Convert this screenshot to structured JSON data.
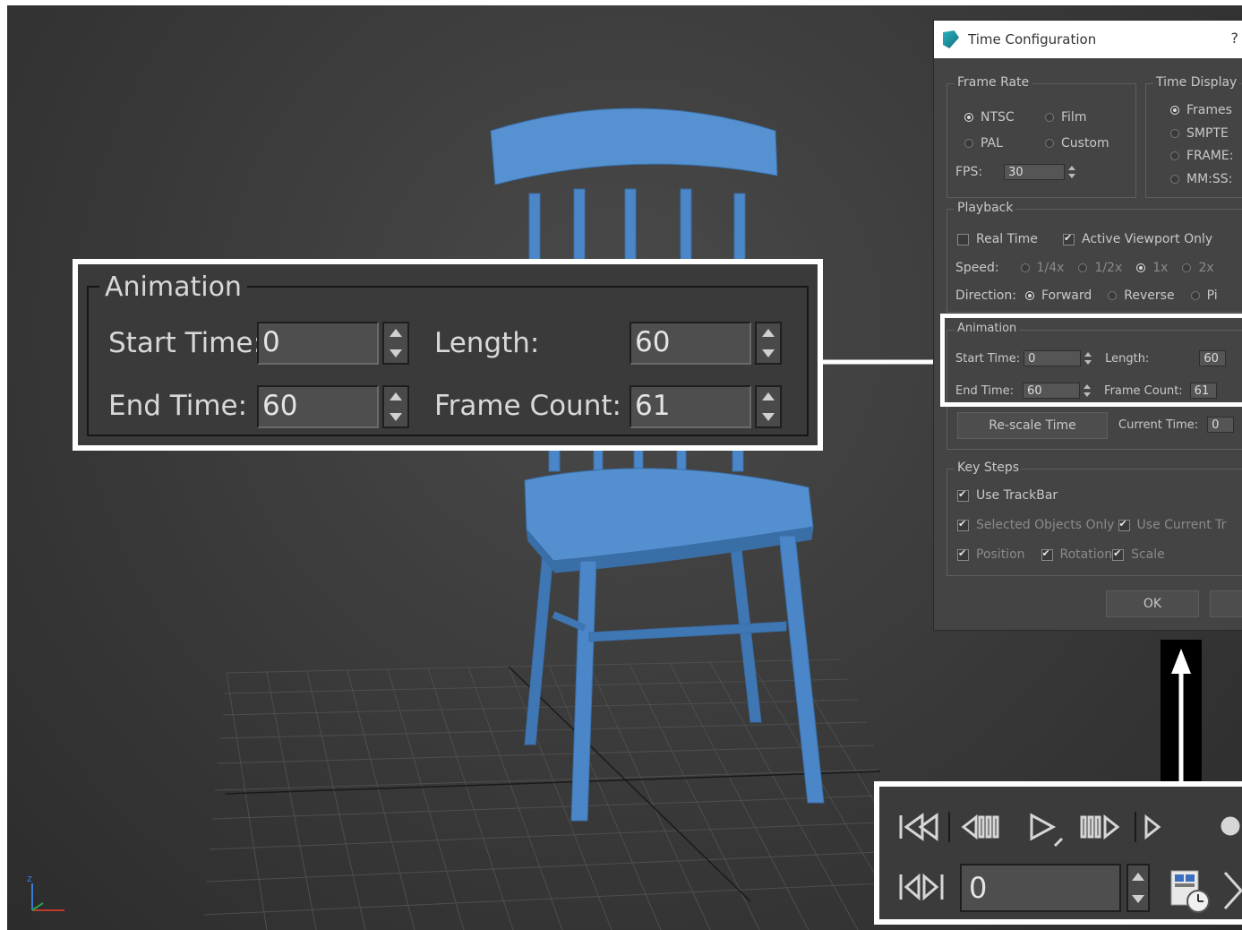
{
  "dialog": {
    "title": "Time Configuration",
    "help_glyph": "?",
    "frame_rate": {
      "label": "Frame Rate",
      "ntsc": "NTSC",
      "film": "Film",
      "pal": "PAL",
      "custom": "Custom",
      "fps_label": "FPS:",
      "fps_value": "30",
      "selected": "NTSC"
    },
    "time_display": {
      "label": "Time Display",
      "frames": "Frames",
      "smpte": "SMPTE",
      "frame_ticks": "FRAME:",
      "mmss": "MM:SS:",
      "selected": "Frames"
    },
    "playback": {
      "label": "Playback",
      "real_time": "Real Time",
      "real_time_checked": false,
      "active_viewport": "Active Viewport Only",
      "active_viewport_checked": true,
      "speed_label": "Speed:",
      "speeds": [
        "1/4x",
        "1/2x",
        "1x",
        "2x"
      ],
      "speed_selected": "1x",
      "direction_label": "Direction:",
      "forward": "Forward",
      "reverse": "Reverse",
      "pingpong": "Pi",
      "direction_selected": "Forward"
    },
    "animation": {
      "label": "Animation",
      "start_label": "Start Time:",
      "start_value": "0",
      "length_label": "Length:",
      "length_value": "60",
      "end_label": "End Time:",
      "end_value": "60",
      "frame_count_label": "Frame Count:",
      "frame_count_value": "61",
      "rescale_button": "Re-scale Time",
      "current_time_label": "Current Time:",
      "current_time_value": "0"
    },
    "key_steps": {
      "label": "Key Steps",
      "use_trackbar": "Use TrackBar",
      "selected_only": "Selected Objects Only",
      "use_current": "Use Current Tr",
      "position": "Position",
      "rotation": "Rotation",
      "scale": "Scale"
    },
    "ok_button": "OK"
  },
  "zoom_panel": {
    "title": "Animation",
    "start_label": "Start Time:",
    "start_value": "0",
    "length_label": "Length:",
    "length_value": "60",
    "end_label": "End Time:",
    "end_value": "60",
    "frame_count_label": "Frame Count:",
    "frame_count_value": "61"
  },
  "toolbar": {
    "current_frame": "0"
  },
  "axis_labels": {
    "z": "z"
  },
  "colors": {
    "chair": "#4a86c8",
    "viewport_bg": "#3c3c3c",
    "dialog_bg": "#444444",
    "highlight": "#ffffff"
  }
}
